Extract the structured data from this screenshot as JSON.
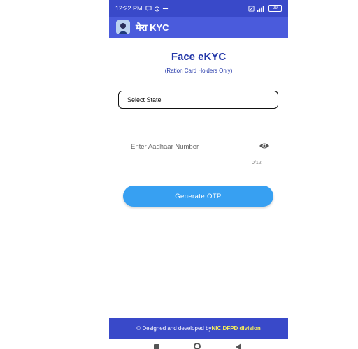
{
  "status_bar": {
    "time": "12:22 PM",
    "battery": "29",
    "left_icons": [
      "message-icon",
      "alarm-icon",
      "minus-icon"
    ],
    "right_icons": [
      "sim-icon",
      "signal-icon",
      "battery-icon"
    ]
  },
  "app_bar": {
    "title": "मेरा KYC",
    "logo_icon": "person-avatar-icon"
  },
  "page": {
    "title": "Face eKYC",
    "subtitle": "(Ration Card Holders Only)"
  },
  "form": {
    "state_select": {
      "selected": "Select State"
    },
    "aadhaar": {
      "placeholder": "Enter Aadhaar Number",
      "counter": "0/12",
      "toggle_icon": "eye-icon"
    },
    "generate_button": "Generate OTP"
  },
  "footer": {
    "prefix": "© Designed and developed by ",
    "org": "NIC",
    "separator": ", ",
    "division": "DFPD division"
  },
  "nav_bar": {
    "icons": [
      "recent-apps-icon",
      "home-icon",
      "back-icon"
    ]
  },
  "colors": {
    "status_bar": "#3949c9",
    "app_bar": "#4a5bdc",
    "title_text": "#2236a8",
    "button": "#37a0f2",
    "footer_highlight": "#f3ec5a"
  }
}
